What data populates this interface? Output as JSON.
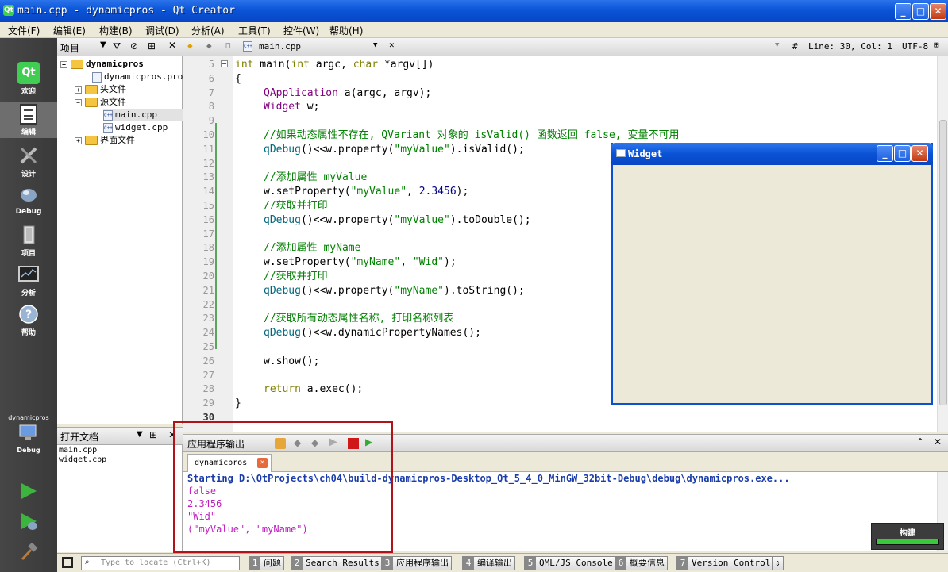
{
  "window": {
    "title": "main.cpp - dynamicpros - Qt Creator",
    "qt_icon_text": "Qt"
  },
  "menu": [
    "文件(F)",
    "编辑(E)",
    "构建(B)",
    "调试(D)",
    "分析(A)",
    "工具(T)",
    "控件(W)",
    "帮助(H)"
  ],
  "modes": [
    {
      "label": "欢迎",
      "icon": "qt-logo-icon"
    },
    {
      "label": "编辑",
      "icon": "edit-document-icon"
    },
    {
      "label": "设计",
      "icon": "design-tools-icon"
    },
    {
      "label": "Debug",
      "icon": "debug-bug-icon"
    },
    {
      "label": "项目",
      "icon": "project-wrench-icon"
    },
    {
      "label": "分析",
      "icon": "analyze-monitor-icon"
    },
    {
      "label": "帮助",
      "icon": "help-question-icon"
    }
  ],
  "kit": {
    "project": "dynamicpros",
    "mode": "Debug"
  },
  "project_panel": {
    "title": "项目",
    "tree": [
      {
        "label": "dynamicpros",
        "level": 0,
        "type": "project"
      },
      {
        "label": "dynamicpros.pro",
        "level": 1,
        "type": "file"
      },
      {
        "label": "头文件",
        "level": 1,
        "type": "folder"
      },
      {
        "label": "源文件",
        "level": 1,
        "type": "folder"
      },
      {
        "label": "main.cpp",
        "level": 2,
        "type": "file"
      },
      {
        "label": "widget.cpp",
        "level": 2,
        "type": "file"
      },
      {
        "label": "界面文件",
        "level": 1,
        "type": "folder"
      }
    ]
  },
  "open_docs": {
    "title": "打开文档",
    "files": [
      "main.cpp",
      "widget.cpp"
    ]
  },
  "editor": {
    "file_tab": "main.cpp",
    "position": "Line: 30, Col: 1",
    "encoding": "UTF-8",
    "hash": "#",
    "line_numbers": [
      "5",
      "6",
      "7",
      "8",
      "9",
      "10",
      "11",
      "12",
      "13",
      "14",
      "15",
      "16",
      "17",
      "18",
      "19",
      "20",
      "21",
      "22",
      "23",
      "24",
      "25",
      "26",
      "27",
      "28",
      "29",
      "30"
    ],
    "code": {
      "l5_int": "int",
      "l5_main": " main(",
      "l5_int2": "int",
      "l5_argc": " argc, ",
      "l5_char": "char",
      "l5_rest": " *argv[])",
      "l6": "{",
      "l7_type": "QApplication",
      "l7_rest": " a(argc, argv);",
      "l8_type": "Widget",
      "l8_rest": " w;",
      "l10": "//如果动态属性不存在, QVariant 对象的 isValid() 函数返回 false, 变量不可用",
      "l11_fn": "qDebug",
      "l11_a": "()<<w.property(",
      "l11_s": "\"myValue\"",
      "l11_b": ").isValid();",
      "l13": "//添加属性 myValue",
      "l14_a": "w.setProperty(",
      "l14_s": "\"myValue\"",
      "l14_b": ", ",
      "l14_n": "2.3456",
      "l14_c": ");",
      "l15": "//获取并打印",
      "l16_fn": "qDebug",
      "l16_a": "()<<w.property(",
      "l16_s": "\"myValue\"",
      "l16_b": ").toDouble();",
      "l18": "//添加属性 myName",
      "l19_a": "w.setProperty(",
      "l19_s": "\"myName\"",
      "l19_b": ", ",
      "l19_s2": "\"Wid\"",
      "l19_c": ");",
      "l20": "//获取并打印",
      "l21_fn": "qDebug",
      "l21_a": "()<<w.property(",
      "l21_s": "\"myName\"",
      "l21_b": ").toString();",
      "l23": "//获取所有动态属性名称, 打印名称列表",
      "l24_fn": "qDebug",
      "l24_a": "()<<w.dynamicPropertyNames();",
      "l26": "w.show();",
      "l28_kw": "return",
      "l28_rest": " a.exec();",
      "l29": "}"
    }
  },
  "widget_window": {
    "title": "Widget"
  },
  "output": {
    "title": "应用程序输出",
    "tab": "dynamicpros",
    "lines": [
      "Starting D:\\QtProjects\\ch04\\build-dynamicpros-Desktop_Qt_5_4_0_MinGW_32bit-Debug\\debug\\dynamicpros.exe...",
      "false",
      "2.3456",
      "\"Wid\"",
      "(\"myValue\", \"myName\")"
    ]
  },
  "statusbar": {
    "locator_placeholder": "Type to locate (Ctrl+K)",
    "tabs": [
      {
        "num": "1",
        "label": "问题"
      },
      {
        "num": "2",
        "label": "Search Results"
      },
      {
        "num": "3",
        "label": "应用程序输出"
      },
      {
        "num": "4",
        "label": "编译输出"
      },
      {
        "num": "5",
        "label": "QML/JS Console"
      },
      {
        "num": "6",
        "label": "概要信息"
      },
      {
        "num": "7",
        "label": "Version Control"
      }
    ]
  },
  "build": {
    "label": "构建",
    "progress": 1.0,
    "color": "#3cc83c"
  },
  "colors": {
    "accent_red": "#b0141a",
    "title_blue": "#0a54d8"
  }
}
